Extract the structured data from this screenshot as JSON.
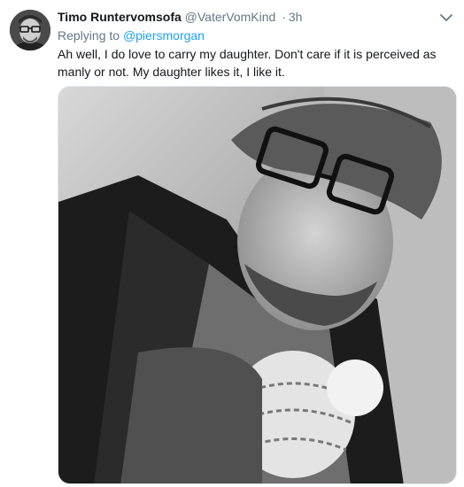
{
  "tweet": {
    "display_name": "Timo Runtervomsofa",
    "handle": "@VaterVomKind",
    "separator": "·",
    "time": "3h",
    "reply_prefix": "Replying to",
    "reply_mention": "@piersmorgan",
    "text": "Ah well, I do love to carry my daughter. Don't care if it is perceived as manly or not. My daughter likes it, I like it."
  },
  "icons": {
    "menu": "chevron-down-icon",
    "avatar": "avatar-photo"
  },
  "colors": {
    "link": "#1da1f2",
    "secondary_text": "#657786",
    "primary_text": "#14171a"
  }
}
